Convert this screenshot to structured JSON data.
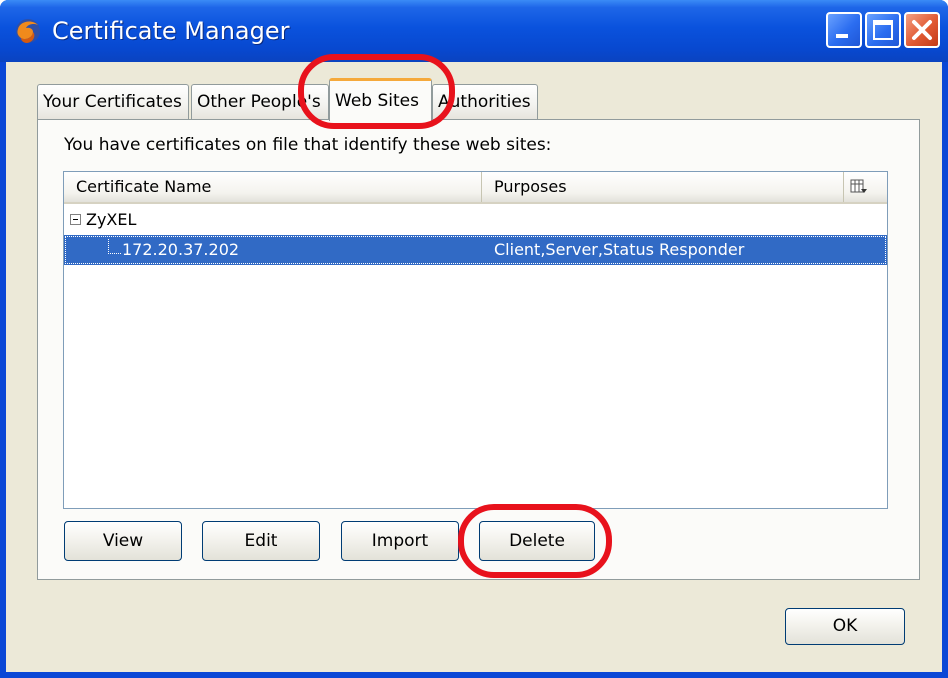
{
  "window": {
    "title": "Certificate Manager",
    "icon": "firefox-icon",
    "controls": [
      "minimize-icon",
      "maximize-icon",
      "close-icon"
    ]
  },
  "tabs": [
    {
      "label": "Your Certificates",
      "selected": false
    },
    {
      "label": "Other People's",
      "selected": false
    },
    {
      "label": "Web Sites",
      "selected": true
    },
    {
      "label": "Authorities",
      "selected": false
    }
  ],
  "panel": {
    "intro": "You have certificates on file that identify these web sites:",
    "columns": [
      "Certificate Name",
      "Purposes"
    ],
    "column_picker_icon": "column-picker-icon",
    "groups": [
      {
        "name": "ZyXEL",
        "expanded": true,
        "items": [
          {
            "name": "172.20.37.202",
            "purposes": "Client,Server,Status Responder",
            "selected": true
          }
        ]
      }
    ]
  },
  "buttons": {
    "view": "View",
    "edit": "Edit",
    "import": "Import",
    "delete": "Delete",
    "ok": "OK"
  },
  "colors": {
    "titlebar": "#0a52dd",
    "selection": "#316ac5",
    "highlight_annotation": "#e8121c",
    "dialog_face": "#ece9d8"
  }
}
